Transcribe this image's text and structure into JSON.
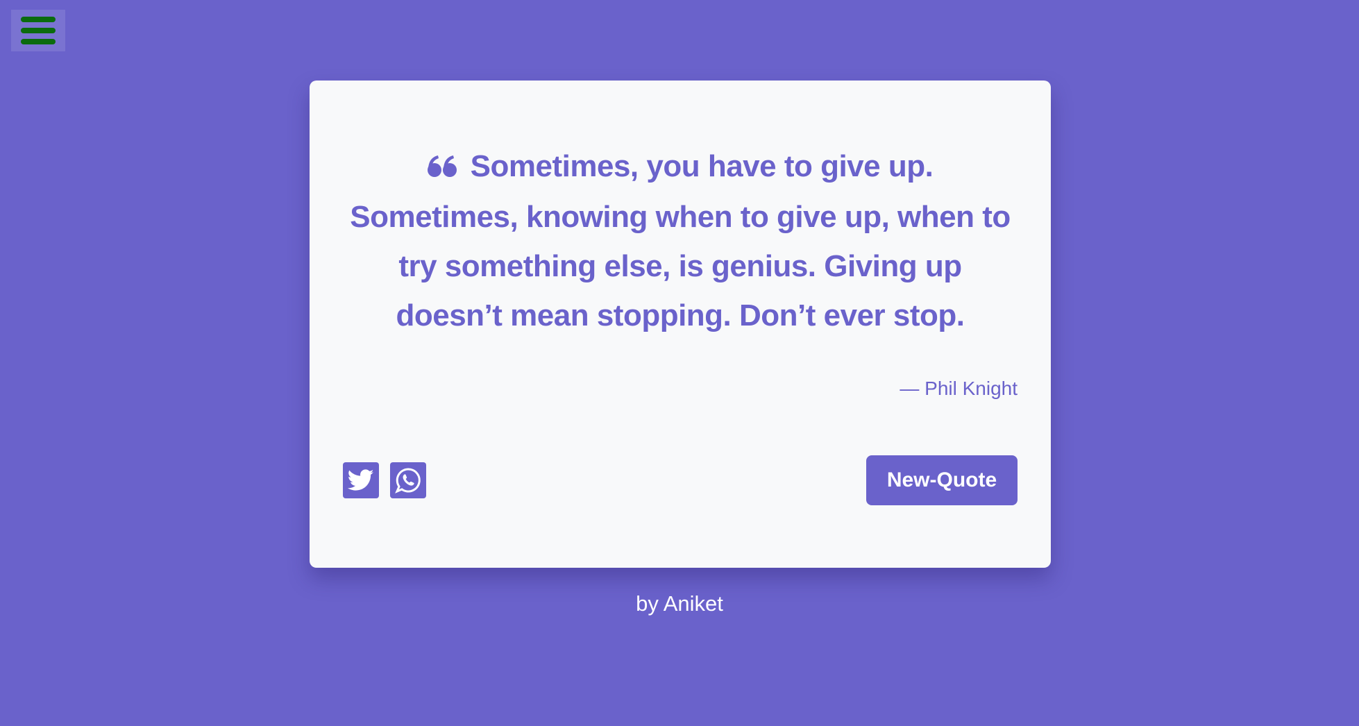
{
  "theme": {
    "background": "#6a62cb",
    "card_background": "#f8f9fa",
    "accent": "#6a62cb",
    "menu_icon_color": "#0b6b0e"
  },
  "menu": {
    "icon": "hamburger-menu-icon"
  },
  "quote": {
    "icon": "quote-left-icon",
    "text": "Sometimes, you have to give up. Sometimes, knowing when to give up, when to try something else, is genius. Giving up doesn’t mean stopping. Don’t ever stop.",
    "author": "— Phil Knight"
  },
  "share": {
    "twitter_icon": "twitter-icon",
    "whatsapp_icon": "whatsapp-icon"
  },
  "actions": {
    "new_quote_label": "New-Quote"
  },
  "footer": {
    "credit": "by Aniket"
  }
}
